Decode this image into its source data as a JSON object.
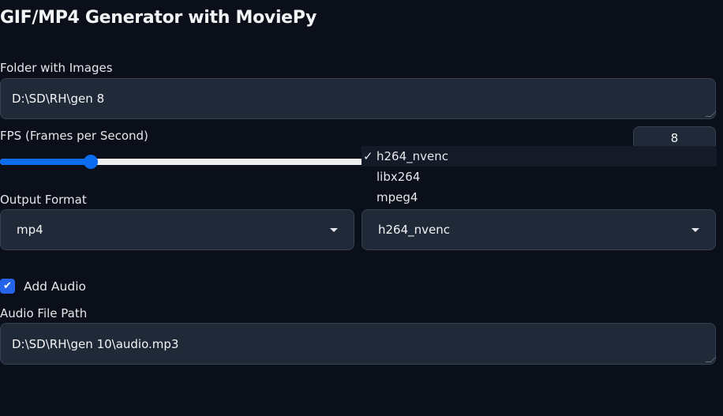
{
  "title": "GIF/MP4 Generator with MoviePy",
  "folder": {
    "label": "Folder with Images",
    "value": "D:\\SD\\RH\\gen 8"
  },
  "fps": {
    "label": "FPS (Frames per Second)",
    "value": "8",
    "slider_fraction": 0.145,
    "accent": "#0b6cf0"
  },
  "output_format": {
    "label": "Output Format",
    "value": "mp4"
  },
  "codec": {
    "value": "h264_nvenc",
    "options": [
      "h264_nvenc",
      "libx264",
      "mpeg4"
    ],
    "selected_mark": "✓"
  },
  "audio": {
    "checkbox_label": "Add Audio",
    "checked": true,
    "check_mark": "✔",
    "path_label": "Audio File Path",
    "path_value": "D:\\SD\\RH\\gen 10\\audio.mp3"
  }
}
